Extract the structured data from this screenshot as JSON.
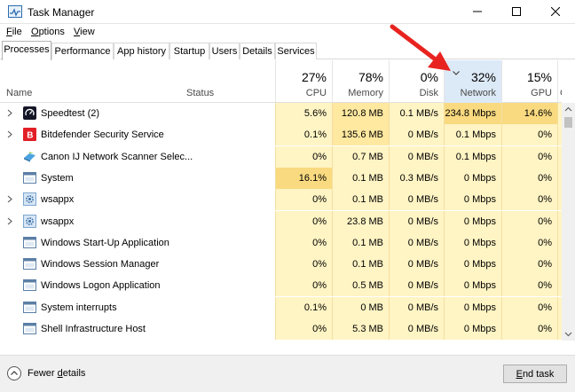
{
  "window": {
    "title": "Task Manager"
  },
  "menu": [
    {
      "label_u": "F",
      "label_rest": "ile"
    },
    {
      "label_u": "O",
      "label_rest": "ptions"
    },
    {
      "label_u": "V",
      "label_rest": "iew"
    }
  ],
  "tabs": [
    "Processes",
    "Performance",
    "App history",
    "Startup",
    "Users",
    "Details",
    "Services"
  ],
  "columns": {
    "name": "Name",
    "status": "Status",
    "cpu": {
      "pct": "27%",
      "label": "CPU"
    },
    "memory": {
      "pct": "78%",
      "label": "Memory"
    },
    "disk": {
      "pct": "0%",
      "label": "Disk"
    },
    "network": {
      "pct": "32%",
      "label": "Network"
    },
    "gpu": {
      "pct": "15%",
      "label": "GPU"
    },
    "gpu_engine": {
      "label": "GP"
    }
  },
  "processes": [
    {
      "name": "Speedtest (2)",
      "cpu": "5.6%",
      "memory": "120.8 MB",
      "disk": "0.1 MB/s",
      "network": "234.8 Mbps",
      "gpu": "14.6%",
      "expandable": true,
      "icon": "speedtest-icon"
    },
    {
      "name": "Bitdefender Security Service",
      "cpu": "0.1%",
      "memory": "135.6 MB",
      "disk": "0 MB/s",
      "network": "0.1 Mbps",
      "gpu": "0%",
      "expandable": true,
      "icon": "bitdefender-icon"
    },
    {
      "name": "Canon IJ Network Scanner Selec...",
      "cpu": "0%",
      "memory": "0.7 MB",
      "disk": "0 MB/s",
      "network": "0.1 Mbps",
      "gpu": "0%",
      "expandable": false,
      "icon": "scanner-icon"
    },
    {
      "name": "System",
      "cpu": "16.1%",
      "memory": "0.1 MB",
      "disk": "0.3 MB/s",
      "network": "0 Mbps",
      "gpu": "0%",
      "expandable": false,
      "icon": "system-window-icon"
    },
    {
      "name": "wsappx",
      "cpu": "0%",
      "memory": "0.1 MB",
      "disk": "0 MB/s",
      "network": "0 Mbps",
      "gpu": "0%",
      "expandable": true,
      "icon": "gear-icon"
    },
    {
      "name": "wsappx",
      "cpu": "0%",
      "memory": "23.8 MB",
      "disk": "0 MB/s",
      "network": "0 Mbps",
      "gpu": "0%",
      "expandable": true,
      "icon": "gear-icon"
    },
    {
      "name": "Windows Start-Up Application",
      "cpu": "0%",
      "memory": "0.1 MB",
      "disk": "0 MB/s",
      "network": "0 Mbps",
      "gpu": "0%",
      "expandable": false,
      "icon": "system-window-icon"
    },
    {
      "name": "Windows Session Manager",
      "cpu": "0%",
      "memory": "0.1 MB",
      "disk": "0 MB/s",
      "network": "0 Mbps",
      "gpu": "0%",
      "expandable": false,
      "icon": "system-window-icon"
    },
    {
      "name": "Windows Logon Application",
      "cpu": "0%",
      "memory": "0.5 MB",
      "disk": "0 MB/s",
      "network": "0 Mbps",
      "gpu": "0%",
      "expandable": false,
      "icon": "system-window-icon"
    },
    {
      "name": "System interrupts",
      "cpu": "0.1%",
      "memory": "0 MB",
      "disk": "0 MB/s",
      "network": "0 Mbps",
      "gpu": "0%",
      "expandable": false,
      "icon": "system-window-icon"
    },
    {
      "name": "Shell Infrastructure Host",
      "cpu": "0%",
      "memory": "5.3 MB",
      "disk": "0 MB/s",
      "network": "0 Mbps",
      "gpu": "0%",
      "expandable": false,
      "icon": "system-window-icon"
    }
  ],
  "footer": {
    "fewer_details_pre": "Fewer ",
    "fewer_details_u": "d",
    "fewer_details_post": "etails",
    "end_task_pre": "",
    "end_task_u": "E",
    "end_task_post": "nd task"
  },
  "colors": {
    "heat_light": "#fff4c4",
    "heat_med": "#ffe8a0",
    "heat_high": "#f9da80",
    "sorted_header": "#dce9f7",
    "annotation_arrow": "#e8231f"
  }
}
